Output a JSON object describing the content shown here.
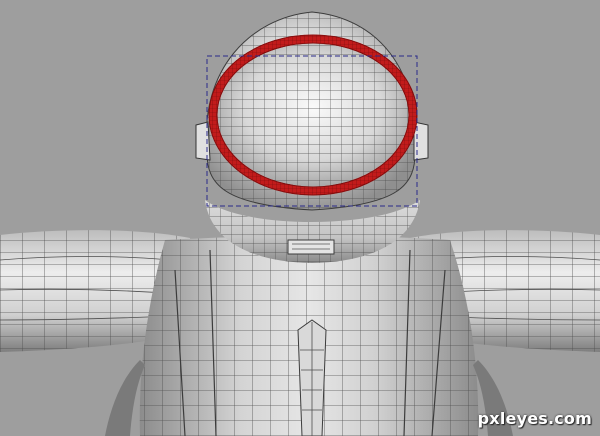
{
  "app": {
    "watermark": "pxleyes.com"
  },
  "viewport": {
    "background_color": "#9e9e9e",
    "mesh_fill_light": "#e8e8e8",
    "mesh_fill_mid": "#c9c9c9",
    "mesh_fill_dark": "#8a8a8a",
    "wire_color": "#555555",
    "selection_color": "#c21b1b",
    "bbox_color": "#2a2a8a"
  },
  "model": {
    "name_icon": "astronaut-mesh-icon",
    "selected_part": "helmet-visor-ring"
  }
}
